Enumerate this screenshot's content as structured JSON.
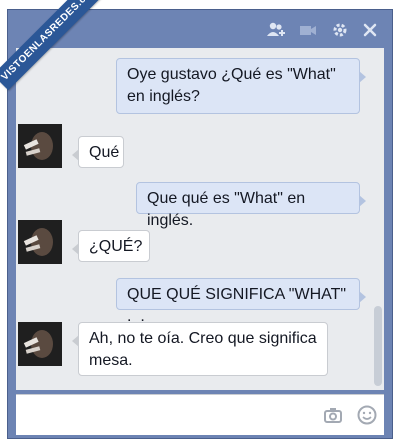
{
  "watermark": "VISTOENLASREDES.com",
  "titlebar": {
    "icons": [
      "add-friend-icon",
      "video-call-icon",
      "gear-icon",
      "close-icon"
    ]
  },
  "messages": [
    {
      "side": "out",
      "text": "Oye gustavo ¿Qué es \"What\" en inglés?"
    },
    {
      "side": "in",
      "text": "Qué"
    },
    {
      "side": "out",
      "text": "Que qué es \"What\" en inglés."
    },
    {
      "side": "in",
      "text": "¿QUÉ?"
    },
    {
      "side": "out",
      "text": "QUE QUÉ SIGNIFICA \"WHAT\" ._."
    },
    {
      "side": "in",
      "text": "Ah, no te oía. Creo que significa mesa."
    }
  ],
  "input": {
    "icons": [
      "camera-icon",
      "emoji-icon"
    ]
  },
  "colors": {
    "frame": "#6d84b4",
    "outgoing_bubble": "#dce5f6",
    "incoming_bubble": "#ffffff",
    "chat_background": "#e9ebee"
  }
}
